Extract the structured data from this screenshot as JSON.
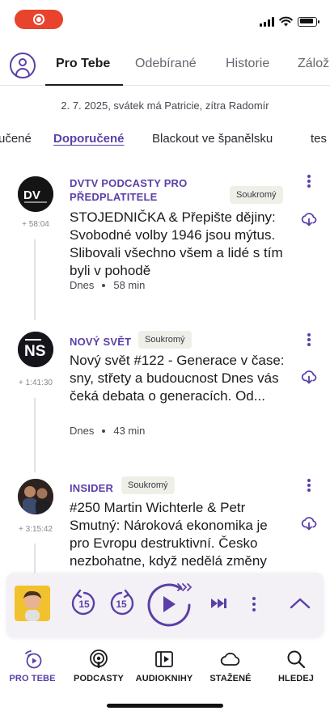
{
  "top_tabs": [
    "Pro Tebe",
    "Odebírané",
    "Historie",
    "Zálož"
  ],
  "date_line": "2. 7. 2025, svátek má Patricie, zítra Radomír",
  "categories": [
    "učené",
    "Doporučené",
    "Blackout ve španělsku",
    "tes"
  ],
  "active_category": "Doporučené",
  "feed": [
    {
      "gap": "+ 58:04",
      "cover_text": "DV",
      "podcast": "DVTV PODCASTY PRO PŘEDPLATITELE",
      "badge": "Soukromý",
      "title": "STOJEDNIČKA & Přepište dějiny: Svobodné volby 1946 jsou mýtus. Slibovali všechno všem a lidé s tím byli v pohodě",
      "day": "Dnes",
      "duration": "58 min"
    },
    {
      "gap": "+ 1:41:30",
      "cover_text": "NS",
      "podcast": "NOVÝ SVĚT",
      "badge": "Soukromý",
      "title": "Nový svět #122 - Generace v čase: sny, střety a budoucnost Dnes vás čeká debata o generacích. Od...",
      "day": "Dnes",
      "duration": "43 min"
    },
    {
      "gap": "+ 3:15:42",
      "cover_text": "",
      "podcast": "INSIDER",
      "badge": "Soukromý",
      "title": "#250 Martin Wichterle & Petr Smutný: Nároková ekonomika je pro Evropu destruktivní. Česko nezbohatne, když nedělá změny",
      "day": "",
      "duration": ""
    }
  ],
  "player": {
    "skip_back": "15",
    "skip_forward": "15"
  },
  "bottom_nav": [
    "PRO TEBE",
    "PODCASTY",
    "AUDIOKNIHY",
    "STAŽENÉ",
    "HLEDEJ"
  ],
  "colors": {
    "accent": "#5b3fa8",
    "badge_bg": "#eef0e8",
    "record_pill": "#e8432d"
  }
}
